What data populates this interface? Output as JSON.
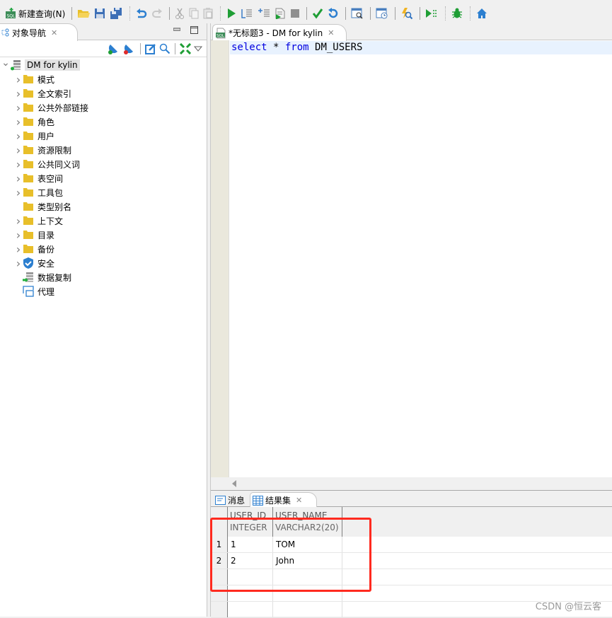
{
  "toolbar": {
    "new_query_label": "新建查询(N)",
    "buttons": [
      "new-query",
      "open-folder",
      "save",
      "save-all",
      "undo",
      "redo",
      "cut",
      "copy",
      "paste",
      "execute",
      "execute-explain",
      "execute-batch",
      "execute-script",
      "stop",
      "commit",
      "rollback",
      "schedule-job",
      "job-history",
      "performance-monitor",
      "debug-step",
      "debug",
      "home"
    ]
  },
  "nav_panel": {
    "tab_title": "对象导航",
    "root": {
      "label": "DM for kylin",
      "expanded": true
    },
    "items": [
      {
        "label": "模式",
        "icon": "folder-icon",
        "expandable": true
      },
      {
        "label": "全文索引",
        "icon": "folder-icon",
        "expandable": true
      },
      {
        "label": "公共外部链接",
        "icon": "folder-icon",
        "expandable": true
      },
      {
        "label": "角色",
        "icon": "folder-icon",
        "expandable": true
      },
      {
        "label": "用户",
        "icon": "folder-icon",
        "expandable": true
      },
      {
        "label": "资源限制",
        "icon": "folder-icon",
        "expandable": true
      },
      {
        "label": "公共同义词",
        "icon": "folder-icon",
        "expandable": true
      },
      {
        "label": "表空间",
        "icon": "folder-icon",
        "expandable": true
      },
      {
        "label": "工具包",
        "icon": "folder-icon",
        "expandable": true
      },
      {
        "label": "类型别名",
        "icon": "folder-icon",
        "expandable": false
      },
      {
        "label": "上下文",
        "icon": "folder-icon",
        "expandable": true
      },
      {
        "label": "目录",
        "icon": "folder-icon",
        "expandable": true
      },
      {
        "label": "备份",
        "icon": "folder-icon",
        "expandable": true
      },
      {
        "label": "安全",
        "icon": "shield-icon",
        "expandable": true
      },
      {
        "label": "数据复制",
        "icon": "replication-icon",
        "expandable": false
      },
      {
        "label": "代理",
        "icon": "agent-icon",
        "expandable": false
      }
    ]
  },
  "editor": {
    "tab_title": "*无标题3 - DM for kylin",
    "sql": {
      "kw1": "select",
      "star": " * ",
      "kw2": "from",
      "table": " DM_USERS"
    }
  },
  "results": {
    "tabs": {
      "messages": "消息",
      "resultset": "结果集"
    },
    "columns": [
      {
        "name": "USER_ID",
        "type": "INTEGER"
      },
      {
        "name": "USER_NAME",
        "type": "VARCHAR2(20)"
      }
    ],
    "rows": [
      {
        "num": "1",
        "user_id": "1",
        "user_name": "TOM"
      },
      {
        "num": "2",
        "user_id": "2",
        "user_name": "John"
      }
    ]
  },
  "watermark": "CSDN @恒云客",
  "colors": {
    "keyword": "#0000e0",
    "highlight_box": "#ff2a1f",
    "folder": "#e8bf2a",
    "current_line": "#e8f2fe",
    "gutter": "#eae8dc"
  }
}
